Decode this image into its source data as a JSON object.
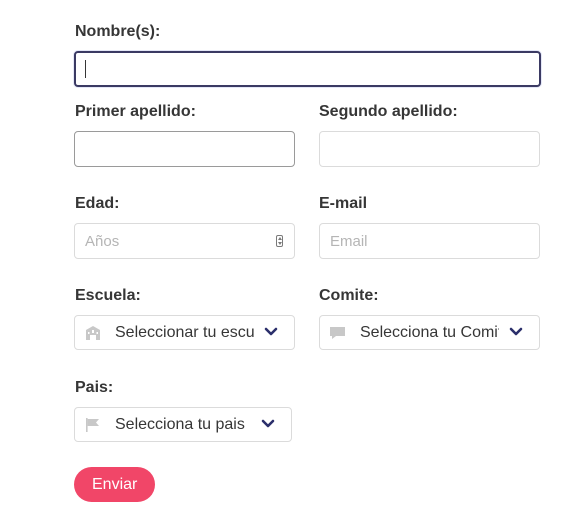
{
  "form": {
    "nombres": {
      "label": "Nombre(s):",
      "value": "",
      "placeholder": ""
    },
    "primer_apellido": {
      "label": "Primer apellido:",
      "value": "",
      "placeholder": ""
    },
    "segundo_apellido": {
      "label": "Segundo apellido:",
      "value": "",
      "placeholder": ""
    },
    "edad": {
      "label": "Edad:",
      "placeholder": "Años"
    },
    "email": {
      "label": "E-mail",
      "placeholder": "Email"
    },
    "escuela": {
      "label": "Escuela:",
      "selected": "Seleccionar tu escuela",
      "icon": "school-icon"
    },
    "comite": {
      "label": "Comite:",
      "selected": "Selecciona tu Comite",
      "icon": "comment-icon"
    },
    "pais": {
      "label": "Pais:",
      "selected": "Selecciona tu pais",
      "icon": "flag-icon"
    },
    "submit_label": "Enviar"
  },
  "colors": {
    "accent": "#f14668",
    "focus_border": "#3b3a63",
    "chevron": "#2b2f6b",
    "icon_grey": "#c8c8c8"
  }
}
